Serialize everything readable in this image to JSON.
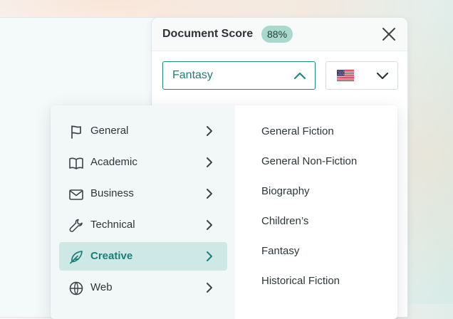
{
  "panel": {
    "title": "Document Score",
    "score": "88%"
  },
  "genre_select": {
    "value": "Fantasy"
  },
  "language_select": {
    "flag": "us-flag-icon"
  },
  "categories": [
    {
      "label": "General",
      "icon": "flag-icon"
    },
    {
      "label": "Academic",
      "icon": "book-icon"
    },
    {
      "label": "Business",
      "icon": "envelope-icon"
    },
    {
      "label": "Technical",
      "icon": "wrench-icon"
    },
    {
      "label": "Creative",
      "icon": "feather-icon",
      "active": true
    },
    {
      "label": "Web",
      "icon": "globe-icon"
    }
  ],
  "subcategories": [
    "General Fiction",
    "General Non-Fiction",
    "Biography",
    "Children’s",
    "Fantasy",
    "Historical Fiction"
  ],
  "colors": {
    "accent": "#1f8a82",
    "active_bg": "#cde8e5",
    "badge_bg": "#a9d8cc"
  }
}
